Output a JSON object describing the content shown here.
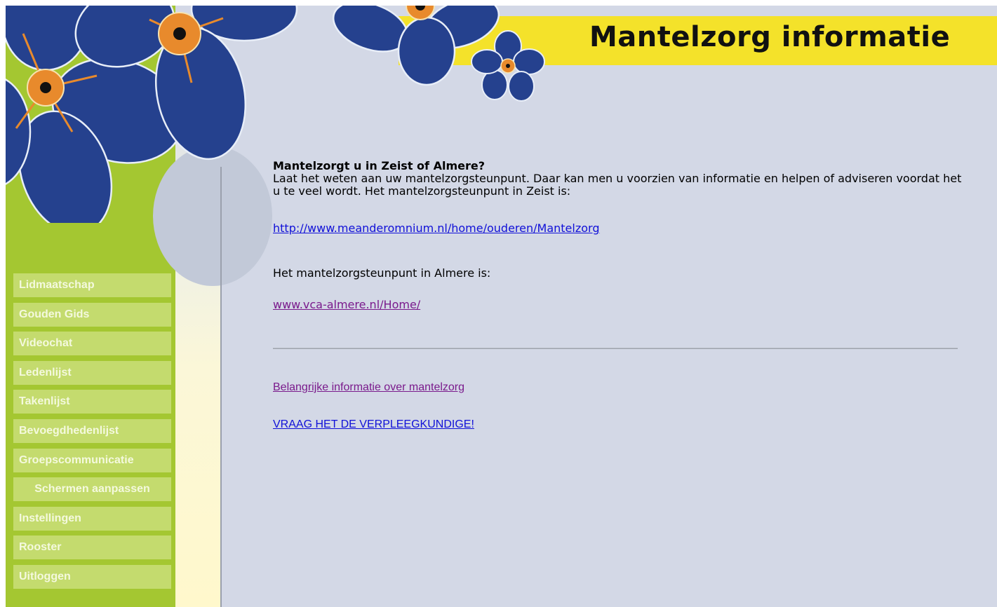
{
  "header": {
    "title": "Mantelzorg informatie"
  },
  "menu": {
    "items": [
      {
        "label": "Lidmaatschap"
      },
      {
        "label": "Gouden Gids"
      },
      {
        "label": "Videochat"
      },
      {
        "label": "Ledenlijst"
      },
      {
        "label": "Takenlijst"
      },
      {
        "label": "Bevoegdhedenlijst"
      },
      {
        "label": "Groepscommunicatie"
      },
      {
        "label": "Schermen aanpassen"
      },
      {
        "label": "Instellingen"
      },
      {
        "label": "Rooster"
      },
      {
        "label": "Uitloggen"
      }
    ]
  },
  "content": {
    "heading": "Mantelzorgt u in Zeist of Almere?",
    "intro": "Laat het weten aan uw mantelzorgsteunpunt. Daar kan men u voorzien van informatie en helpen of adviseren voordat het u te veel wordt. Het mantelzorgsteunpunt in Zeist is:",
    "zeist_link": "http://www.meanderomnium.nl/home/ouderen/Mantelzorg",
    "almere_text": "Het mantelzorgsteunpunt in Almere is:",
    "almere_link": "www.vca-almere.nl/Home/",
    "info_link": "Belangrijke informatie over mantelzorg",
    "nurse_link": "VRAAG HET DE VERPLEEGKUNDIGE!"
  },
  "colors": {
    "background": "#d3d8e6",
    "sidebar": "#a4c731",
    "menu_item": "#c4db6e",
    "title_band": "#f4e22a",
    "flower": "#25418e",
    "flower_center": "#e88a2c"
  }
}
